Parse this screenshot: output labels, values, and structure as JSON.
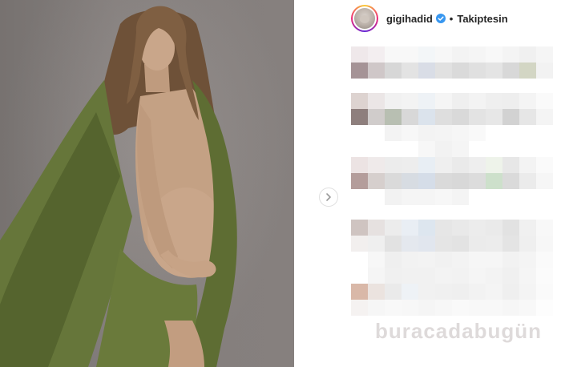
{
  "post": {
    "username": "gigihadid",
    "follow_state": "Takiptesin",
    "separator": "•",
    "watermark": "buracadabugün"
  },
  "colors": {
    "dress": "#6b7a38",
    "dress_dark": "#4a5627",
    "skin": "#c6a084",
    "hair": "#7a5a3e",
    "background_wall": "#8a8482",
    "verified": "#3897f0"
  },
  "icons": {
    "verified": "verified-badge-icon",
    "next": "chevron-right-icon"
  }
}
